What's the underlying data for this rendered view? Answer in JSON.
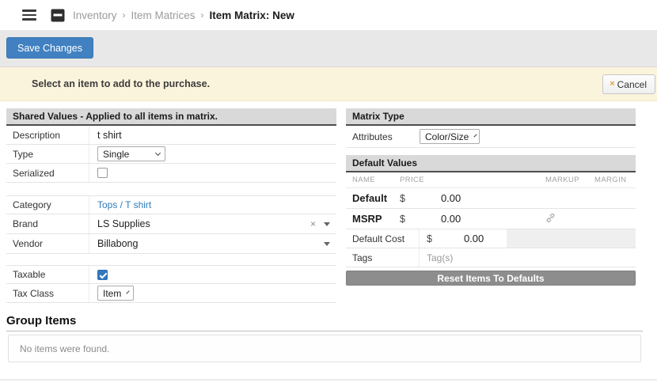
{
  "breadcrumb": {
    "separator": "›",
    "items": [
      "Inventory",
      "Item Matrices"
    ],
    "current": "Item Matrix: New"
  },
  "toolbar": {
    "save_label": "Save Changes"
  },
  "banner": {
    "message": "Select an item to add to the purchase.",
    "cancel_label": "Cancel",
    "cancel_icon": "×"
  },
  "shared_values": {
    "title": "Shared Values - Applied to all items in matrix.",
    "description": {
      "label": "Description",
      "value": "t shirt"
    },
    "type": {
      "label": "Type",
      "value": "Single"
    },
    "serialized": {
      "label": "Serialized",
      "checked": false
    },
    "category": {
      "label": "Category",
      "value": "Tops / T shirt"
    },
    "brand": {
      "label": "Brand",
      "value": "LS Supplies",
      "clear_icon": "×"
    },
    "vendor": {
      "label": "Vendor",
      "value": "Billabong"
    },
    "taxable": {
      "label": "Taxable",
      "checked": true
    },
    "tax_class": {
      "label": "Tax Class",
      "value": "Item"
    }
  },
  "matrix_type": {
    "title": "Matrix Type",
    "attributes": {
      "label": "Attributes",
      "value": "Color/Size"
    }
  },
  "default_values": {
    "title": "Default Values",
    "columns": {
      "name": "NAME",
      "price": "PRICE",
      "markup": "MARKUP",
      "margin": "MARGIN"
    },
    "rows": [
      {
        "name": "Default",
        "currency": "$",
        "price": "0.00",
        "linked": false
      },
      {
        "name": "MSRP",
        "currency": "$",
        "price": "0.00",
        "linked": true
      }
    ],
    "default_cost": {
      "label": "Default Cost",
      "currency": "$",
      "value": "0.00"
    },
    "tags": {
      "label": "Tags",
      "placeholder": "Tag(s)"
    },
    "reset_label": "Reset Items To Defaults"
  },
  "group_items": {
    "title": "Group Items",
    "empty_message": "No items were found."
  },
  "colors": {
    "primary_button_blue": "#4181c1",
    "banner_background": "#fbf4dc",
    "section_header_gray": "#d9d9d9",
    "section_header_border": "#4d4d4d",
    "link_blue": "#2e7ab8",
    "checkbox_checked_blue": "#2f79c0",
    "reset_button_gray": "#8d8d8d",
    "cancel_x_orange": "#e9a13b"
  }
}
